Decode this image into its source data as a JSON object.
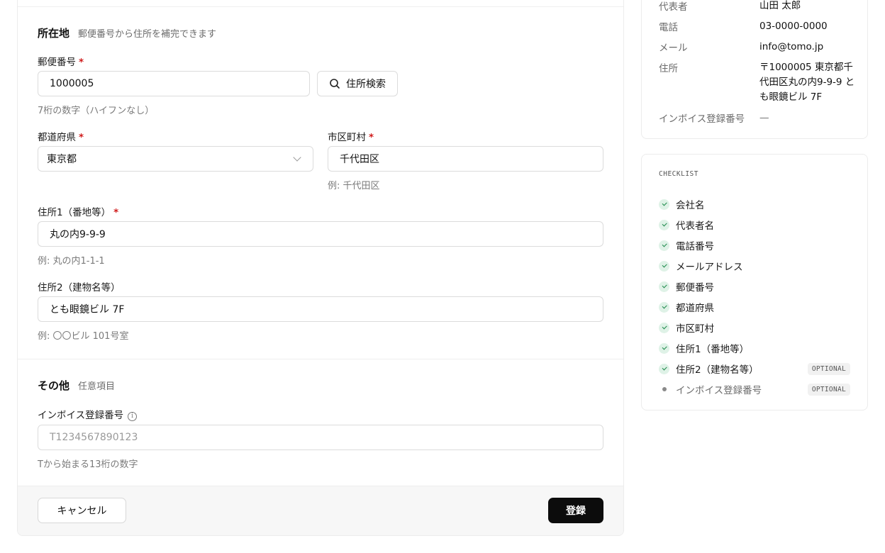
{
  "address_section": {
    "title": "所在地",
    "subtitle": "郵便番号から住所を補完できます",
    "postal": {
      "label": "郵便番号",
      "value": "1000005",
      "hint": "7桁の数字（ハイフンなし）"
    },
    "search_button": "住所検索",
    "prefecture": {
      "label": "都道府県",
      "value": "東京都"
    },
    "city": {
      "label": "市区町村",
      "value": "千代田区",
      "hint": "例: 千代田区"
    },
    "address1": {
      "label": "住所1（番地等）",
      "value": "丸の内9-9-9",
      "hint": "例: 丸の内1-1-1"
    },
    "address2": {
      "label": "住所2（建物名等）",
      "value": "とも眼鏡ビル 7F",
      "hint": "例: 〇〇ビル 101号室"
    },
    "required_mark": "*"
  },
  "other_section": {
    "title": "その他",
    "subtitle": "任意項目",
    "invoice": {
      "label": "インボイス登録番号",
      "placeholder": "T1234567890123",
      "hint": "Tから始まる13桁の数字"
    }
  },
  "footer": {
    "cancel": "キャンセル",
    "submit": "登録"
  },
  "summary": {
    "rows": [
      {
        "key": "代表者",
        "value": "山田 太郎"
      },
      {
        "key": "電話",
        "value": "03-0000-0000"
      },
      {
        "key": "メール",
        "value": "info@tomo.jp"
      },
      {
        "key": "住所",
        "value": "〒1000005 東京都千代田区丸の内9-9-9 とも眼鏡ビル 7F"
      },
      {
        "key": "インボイス登録番号",
        "value": "—"
      }
    ]
  },
  "checklist": {
    "title": "CHECKLIST",
    "items": [
      {
        "label": "会社名",
        "done": true
      },
      {
        "label": "代表者名",
        "done": true
      },
      {
        "label": "電話番号",
        "done": true
      },
      {
        "label": "メールアドレス",
        "done": true
      },
      {
        "label": "郵便番号",
        "done": true
      },
      {
        "label": "都道府県",
        "done": true
      },
      {
        "label": "市区町村",
        "done": true
      },
      {
        "label": "住所1（番地等）",
        "done": true
      },
      {
        "label": "住所2（建物名等）",
        "done": true,
        "badge": "OPTIONAL"
      },
      {
        "label": "インボイス登録番号",
        "done": false,
        "badge": "OPTIONAL"
      }
    ]
  },
  "colors": {
    "required": "#d01c1c",
    "check_bg": "#dff2e7",
    "check_tick": "#1f8a4c",
    "primary_button": "#0c0c0c"
  }
}
